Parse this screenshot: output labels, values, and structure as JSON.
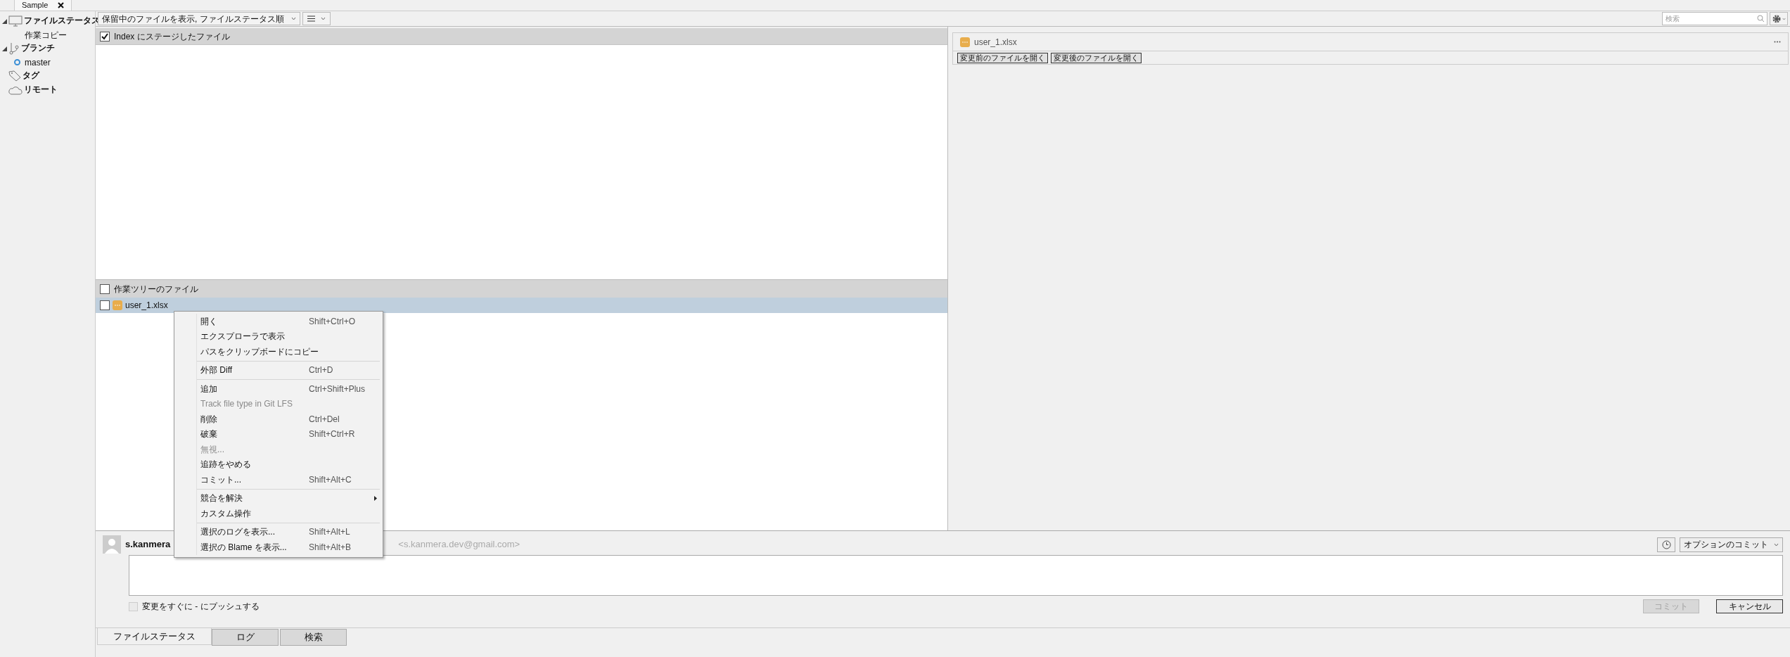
{
  "tab": {
    "title": "Sample"
  },
  "sidebar": {
    "items": [
      {
        "label": "ファイルステータス",
        "expanded": true,
        "children": [
          {
            "label": "作業コピー"
          }
        ]
      },
      {
        "label": "ブランチ",
        "expanded": true,
        "children": [
          {
            "label": "master",
            "current": true
          }
        ]
      },
      {
        "label": "タグ"
      },
      {
        "label": "リモート"
      }
    ]
  },
  "toolbar": {
    "filter": "保留中のファイルを表示, ファイルステータス順",
    "search_placeholder": "検索"
  },
  "staged": {
    "label": "Index にステージしたファイル",
    "checked": true
  },
  "unstaged": {
    "label": "作業ツリーのファイル",
    "checked": false,
    "files": [
      {
        "name": "user_1.xlsx",
        "checked": false,
        "selected": true
      }
    ]
  },
  "context_menu": {
    "items": [
      {
        "kind": "item",
        "label": "開く",
        "shortcut": "Shift+Ctrl+O",
        "disabled": false
      },
      {
        "kind": "item",
        "label": "エクスプローラで表示",
        "disabled": false
      },
      {
        "kind": "item",
        "label": "パスをクリップボードにコピー",
        "disabled": false
      },
      {
        "kind": "separator"
      },
      {
        "kind": "item",
        "label": "外部 Diff",
        "shortcut": "Ctrl+D",
        "disabled": false
      },
      {
        "kind": "separator"
      },
      {
        "kind": "item",
        "label": "追加",
        "shortcut": "Ctrl+Shift+Plus",
        "disabled": false
      },
      {
        "kind": "item",
        "label": "Track file type in Git LFS",
        "disabled": true
      },
      {
        "kind": "item",
        "label": "削除",
        "shortcut": "Ctrl+Del",
        "disabled": false
      },
      {
        "kind": "item",
        "label": "破棄",
        "shortcut": "Shift+Ctrl+R",
        "disabled": false
      },
      {
        "kind": "item",
        "label": "無視...",
        "disabled": true
      },
      {
        "kind": "item",
        "label": "追跡をやめる",
        "disabled": false
      },
      {
        "kind": "item",
        "label": "コミット...",
        "shortcut": "Shift+Alt+C",
        "disabled": false
      },
      {
        "kind": "separator"
      },
      {
        "kind": "item",
        "label": "競合を解決",
        "submenu": true,
        "disabled": false
      },
      {
        "kind": "item",
        "label": "カスタム操作",
        "disabled": false
      },
      {
        "kind": "separator"
      },
      {
        "kind": "item",
        "label": "選択のログを表示...",
        "shortcut": "Shift+Alt+L",
        "disabled": false
      },
      {
        "kind": "item",
        "label": "選択の Blame を表示...",
        "shortcut": "Shift+Alt+B",
        "disabled": false
      }
    ]
  },
  "diff_panel": {
    "file": "user_1.xlsx",
    "buttons": [
      "変更前のファイルを開く",
      "変更後のファイルを開く"
    ]
  },
  "commit": {
    "author": "s.kanmera",
    "email": "<s.kanmera.dev@gmail.com>",
    "options": "オプションのコミット",
    "push_label": "変更をすぐに - にプッシュする",
    "push_checked": false,
    "commit_button": {
      "label": "コミット",
      "disabled": true
    },
    "cancel": "キャンセル"
  },
  "bottom_tabs": [
    {
      "label": "ファイルステータス",
      "selected": true
    },
    {
      "label": "ログ",
      "selected": false
    },
    {
      "label": "検索",
      "selected": false
    }
  ]
}
